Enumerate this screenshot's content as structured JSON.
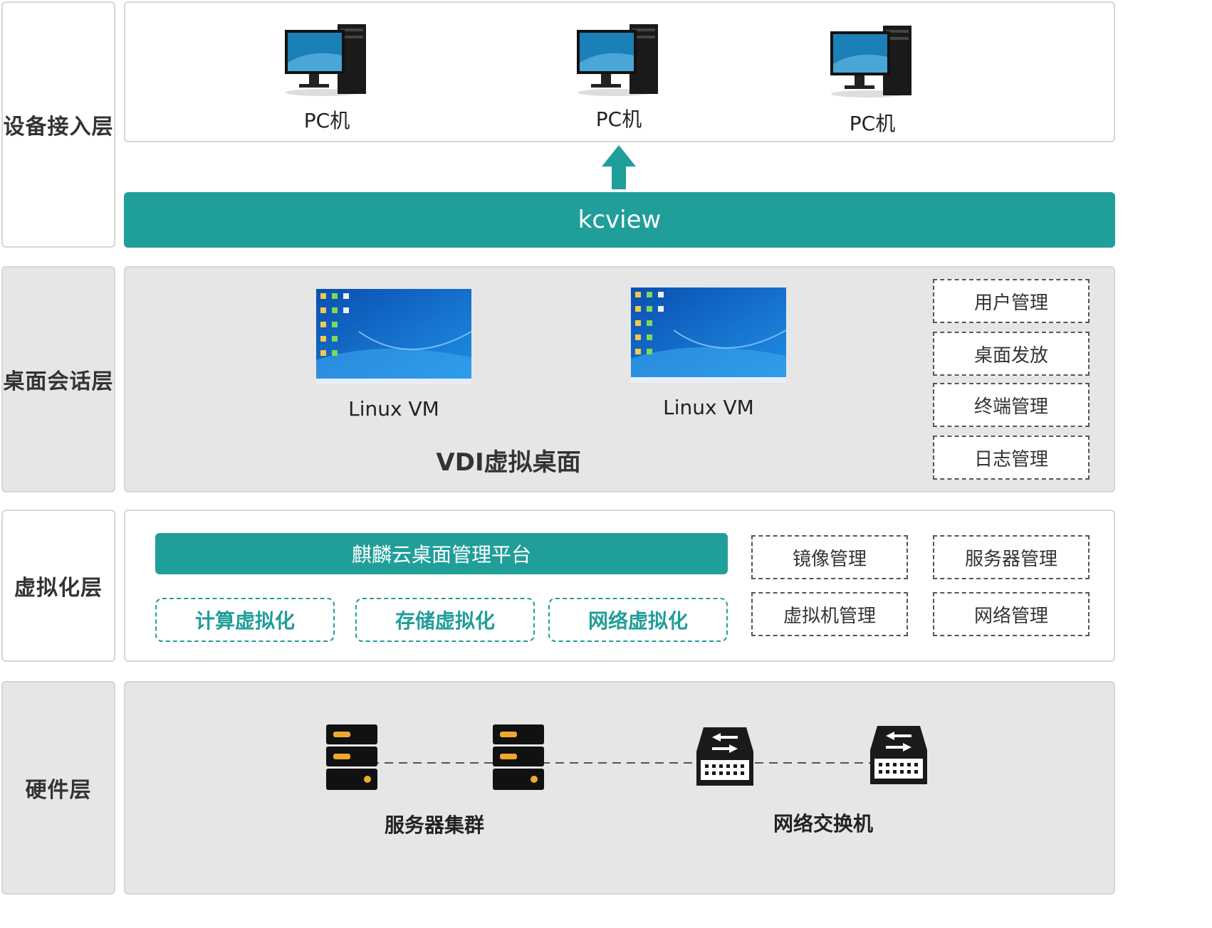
{
  "layers": {
    "device": {
      "label": "设备接入层",
      "pcs": [
        "PC机",
        "PC机",
        "PC机"
      ],
      "gateway": "kcview"
    },
    "session": {
      "label": "桌面会话层",
      "vms": [
        "Linux VM",
        "Linux VM"
      ],
      "title": "VDI虚拟桌面",
      "mgmt": [
        "用户管理",
        "桌面发放",
        "终端管理",
        "日志管理"
      ]
    },
    "virt": {
      "label": "虚拟化层",
      "platform": "麒麟云桌面管理平台",
      "types": [
        "计算虚拟化",
        "存储虚拟化",
        "网络虚拟化"
      ],
      "mgmt": [
        "镜像管理",
        "服务器管理",
        "虚拟机管理",
        "网络管理"
      ]
    },
    "hardware": {
      "label": "硬件层",
      "server_caption": "服务器集群",
      "switch_caption": "网络交换机"
    }
  },
  "colors": {
    "accent": "#209e99",
    "layer_bg": "#e6e6e6",
    "border": "#d6d6d6"
  },
  "icons": [
    "desktop-pc-icon",
    "up-arrow-icon",
    "desktop-screen-icon",
    "server-icon",
    "network-switch-icon"
  ]
}
